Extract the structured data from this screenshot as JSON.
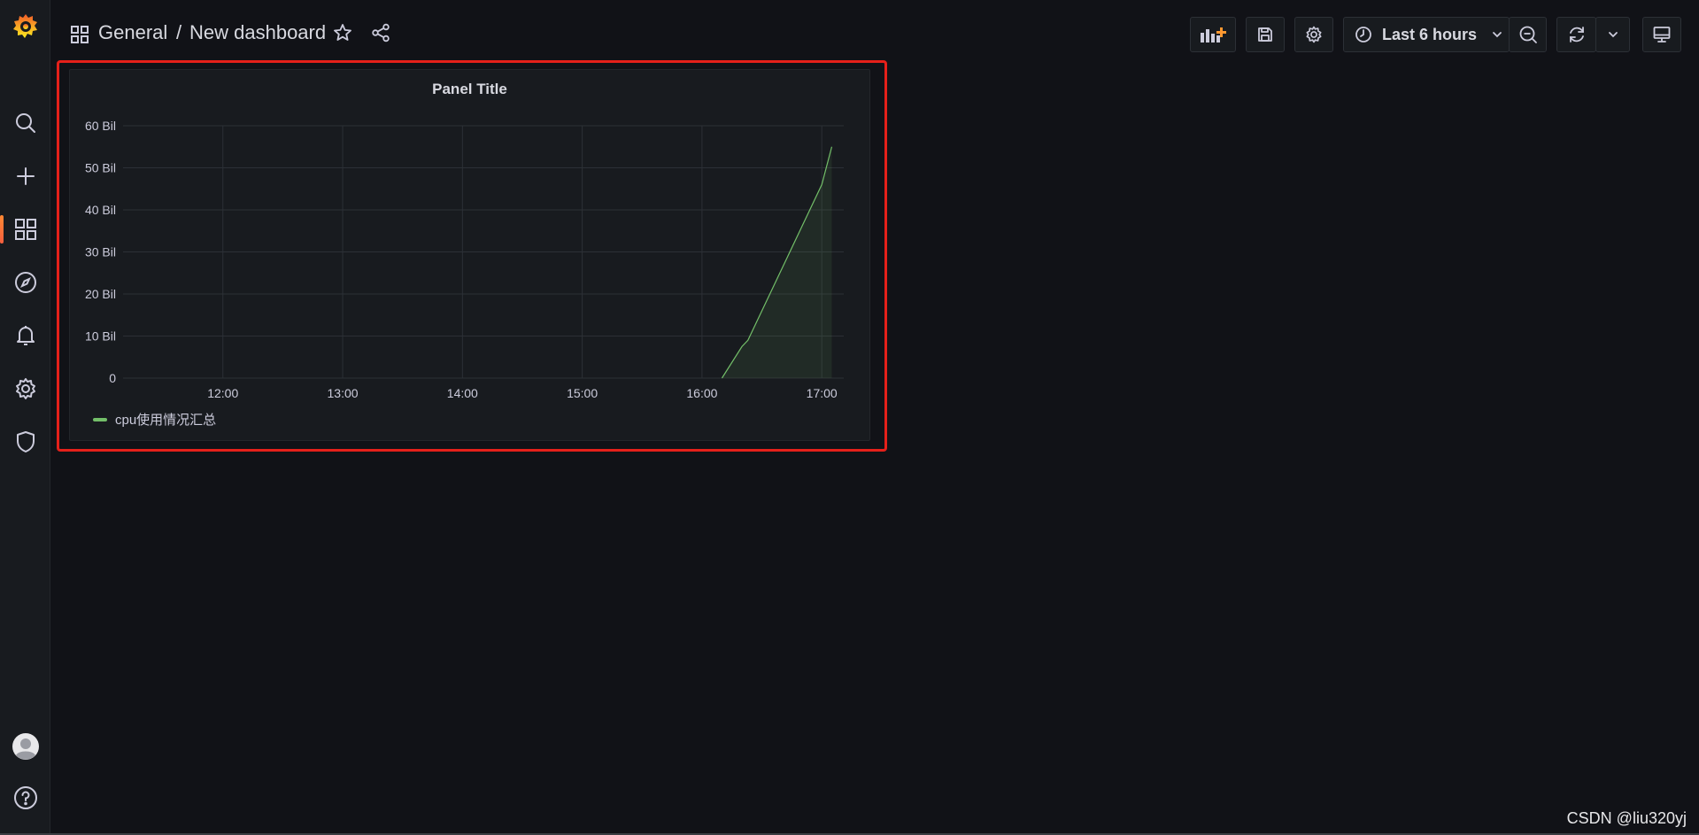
{
  "sidebar": {
    "items": [
      {
        "icon": "grafana-logo-icon"
      },
      {
        "icon": "search-icon"
      },
      {
        "icon": "plus-icon"
      },
      {
        "icon": "dashboards-icon",
        "active": true
      },
      {
        "icon": "explore-compass-icon"
      },
      {
        "icon": "alerting-bell-icon"
      },
      {
        "icon": "configuration-gear-icon"
      },
      {
        "icon": "server-admin-shield-icon"
      },
      {
        "icon": "user-avatar-icon"
      },
      {
        "icon": "help-icon"
      }
    ]
  },
  "header": {
    "folder": "General",
    "separator": "/",
    "title": "New dashboard"
  },
  "toolbar": {
    "time_range": "Last 6 hours",
    "buttons": [
      "add-panel-icon",
      "save-icon",
      "settings-icon",
      "zoom-out-icon",
      "refresh-icon",
      "refresh-interval-chevron-icon",
      "tv-mode-icon"
    ]
  },
  "panel": {
    "title": "Panel Title"
  },
  "chart_data": {
    "type": "area",
    "title": "Panel Title",
    "x_ticks": [
      "12:00",
      "13:00",
      "14:00",
      "15:00",
      "16:00",
      "17:00"
    ],
    "y_ticks": [
      "0",
      "10 Bil",
      "20 Bil",
      "30 Bil",
      "40 Bil",
      "50 Bil",
      "60 Bil"
    ],
    "ylim": [
      0,
      60
    ],
    "y_unit": "Bil",
    "grid": true,
    "legend_position": "bottom-left",
    "series": [
      {
        "name": "cpu使用情况汇总",
        "color": "#73bf69",
        "x": [
          "16:10",
          "16:20",
          "16:23",
          "16:30",
          "16:40",
          "16:50",
          "17:00",
          "17:05"
        ],
        "values": [
          0,
          7.5,
          9,
          16,
          26,
          36,
          46,
          55
        ]
      }
    ]
  },
  "watermark": "CSDN @liu320yj"
}
